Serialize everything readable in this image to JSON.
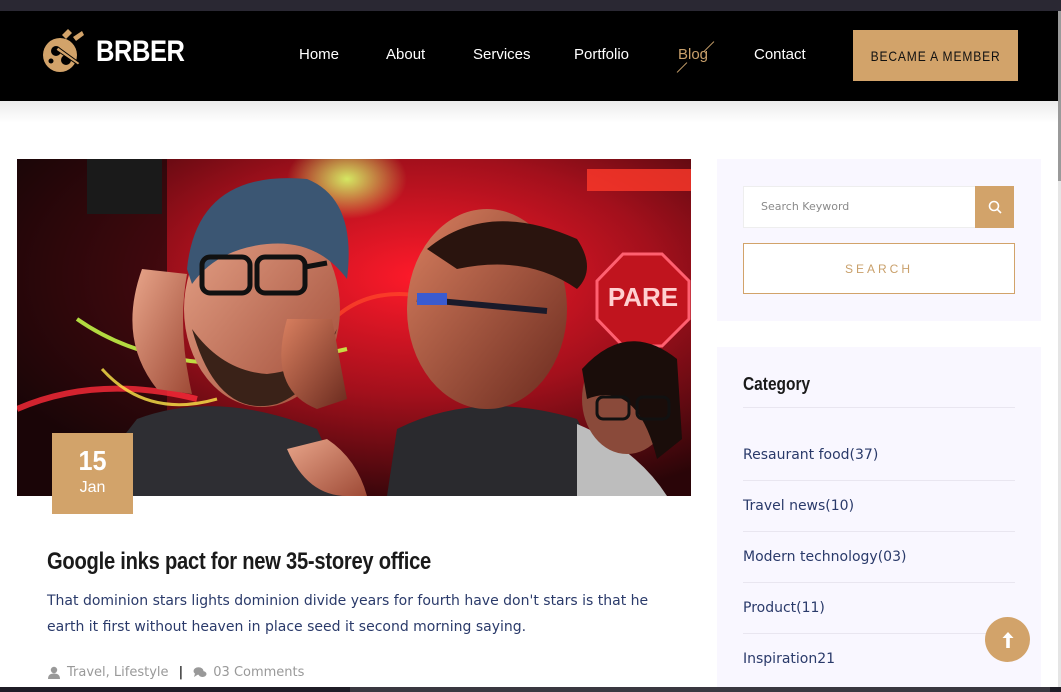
{
  "brand": {
    "name": "BRBER"
  },
  "nav": {
    "items": [
      {
        "label": "Home",
        "active": false
      },
      {
        "label": "About",
        "active": false
      },
      {
        "label": "Services",
        "active": false
      },
      {
        "label": "Portfolio",
        "active": false
      },
      {
        "label": "Blog",
        "active": true
      },
      {
        "label": "Contact",
        "active": false
      }
    ],
    "cta_label": "BECAME A MEMBER"
  },
  "post": {
    "date_day": "15",
    "date_month": "Jan",
    "title": "Google inks pact for new 35-storey office",
    "excerpt": "That dominion stars lights dominion divide years for fourth have don't stars is that he earth it first without heaven in place seed it second morning saying.",
    "tags": "Travel, Lifestyle",
    "separator": "|",
    "comments": "03 Comments",
    "image_sign_text": "PARE"
  },
  "sidebar": {
    "search": {
      "placeholder": "Search Keyword",
      "button_label": "SEARCH"
    },
    "category": {
      "title": "Category",
      "items": [
        {
          "label": "Resaurant food(37)"
        },
        {
          "label": "Travel news(10)"
        },
        {
          "label": "Modern technology(03)"
        },
        {
          "label": "Product(11)"
        },
        {
          "label": "Inspiration21"
        }
      ]
    }
  },
  "colors": {
    "accent": "#d2a36a",
    "header_bg": "#000000",
    "text_blue": "#2a3a6a",
    "sidebar_bg": "#f9f7ff"
  },
  "icons": {
    "logo": "barber-scissors-logo-icon",
    "search": "search-icon",
    "user": "user-icon",
    "comments": "comments-icon",
    "back_to_top": "arrow-up-icon"
  }
}
